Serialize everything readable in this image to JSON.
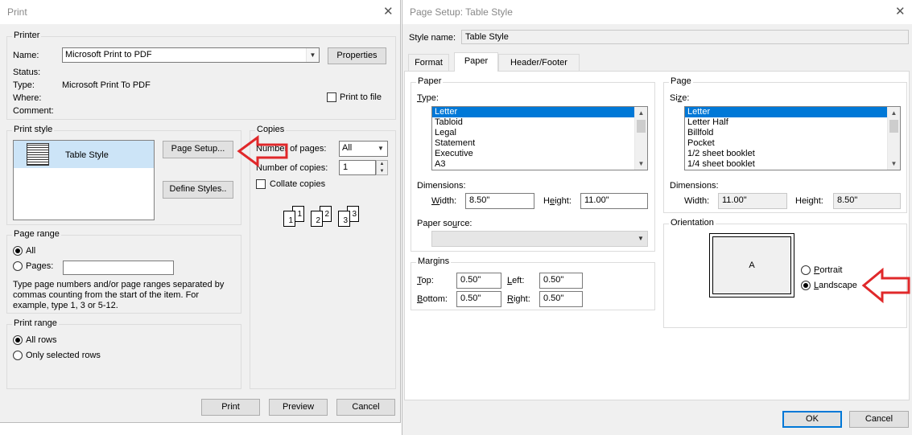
{
  "print_dialog": {
    "title": "Print",
    "printer": {
      "group_label": "Printer",
      "name_label": "Name:",
      "name_value": "Microsoft Print to PDF",
      "properties_button": "Properties",
      "status_label": "Status:",
      "type_label": "Type:",
      "type_value": "Microsoft Print To PDF",
      "where_label": "Where:",
      "comment_label": "Comment:",
      "print_to_file_label": "Print to file"
    },
    "print_style": {
      "group_label": "Print style",
      "selected_style": "Table Style",
      "page_setup_button": "Page Setup...",
      "define_styles_button": "Define Styles.."
    },
    "copies": {
      "group_label": "Copies",
      "number_of_pages_label": "Number of pages:",
      "number_of_pages_value": "All",
      "number_of_copies_label": "Number of copies:",
      "number_of_copies_value": "1",
      "collate_label": "Collate copies",
      "collate_pages": [
        "1",
        "1",
        "2",
        "2",
        "3",
        "3"
      ]
    },
    "page_range": {
      "group_label": "Page range",
      "all_label": "All",
      "pages_label": "Pages:",
      "pages_value": "",
      "help_line1": "Type page numbers and/or page ranges separated by",
      "help_line2": "commas counting from the start of the item.  For",
      "help_line3": "example, type 1, 3 or 5-12."
    },
    "print_range": {
      "group_label": "Print range",
      "all_rows_label": "All rows",
      "selected_rows_label": "Only selected rows"
    },
    "buttons": {
      "print": "Print",
      "preview": "Preview",
      "cancel": "Cancel"
    }
  },
  "page_setup_dialog": {
    "title": "Page Setup: Table Style",
    "style_name_label": "Style name:",
    "style_name_value": "Table Style",
    "tabs": [
      {
        "label": "Format"
      },
      {
        "label": "Paper"
      },
      {
        "label": "Header/Footer"
      }
    ],
    "paper": {
      "group_label": "Paper",
      "type_label": "Type:",
      "types": [
        "Letter",
        "Tabloid",
        "Legal",
        "Statement",
        "Executive",
        "A3"
      ],
      "selected_type": "Letter",
      "dimensions_label": "Dimensions:",
      "width_label": "Width:",
      "width_value": "8.50\"",
      "height_label": "Height:",
      "height_value": "11.00\"",
      "paper_source_label": "Paper source:"
    },
    "page": {
      "group_label": "Page",
      "size_label": "Size:",
      "sizes": [
        "Letter",
        "Letter Half",
        "Billfold",
        "Pocket",
        "1/2 sheet booklet",
        "1/4 sheet booklet"
      ],
      "selected_size": "Letter",
      "dimensions_label": "Dimensions:",
      "width_label": "Width:",
      "width_value": "11.00\"",
      "height_label": "Height:",
      "height_value": "8.50\""
    },
    "margins": {
      "group_label": "Margins",
      "top_label": "Top:",
      "top_value": "0.50\"",
      "left_label": "Left:",
      "left_value": "0.50\"",
      "bottom_label": "Bottom:",
      "bottom_value": "0.50\"",
      "right_label": "Right:",
      "right_value": "0.50\""
    },
    "orientation": {
      "group_label": "Orientation",
      "preview_letter": "A",
      "portrait_label": "Portrait",
      "landscape_label": "Landscape",
      "selected": "Landscape"
    },
    "buttons": {
      "ok": "OK",
      "cancel": "Cancel"
    }
  },
  "colors": {
    "selection": "#0078d7",
    "annotation_arrow": "#e0282a",
    "dialog_bg": "#f0f0f0"
  }
}
